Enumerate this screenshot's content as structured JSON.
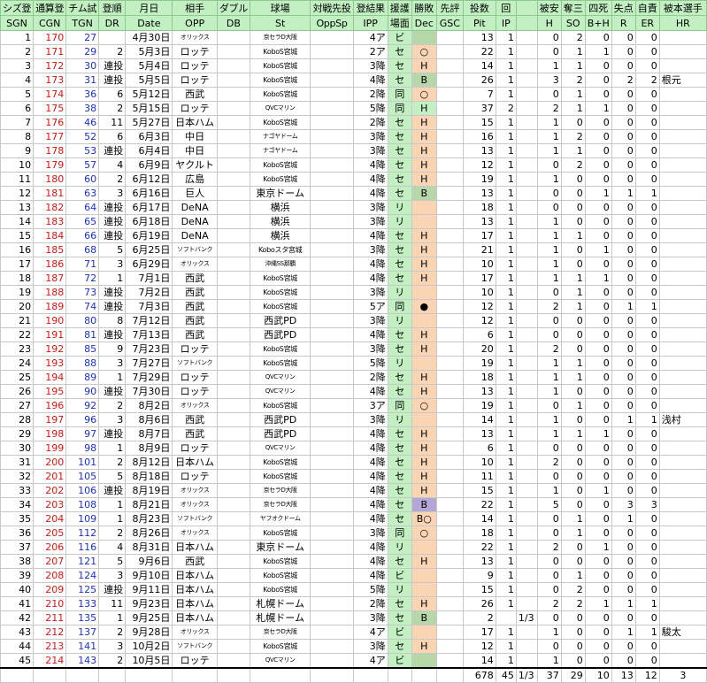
{
  "headers_jp": [
    "シズ登",
    "通算登",
    "チム試",
    "登順",
    "月日",
    "相手",
    "ダブル",
    "球場",
    "対戦先投",
    "登結果",
    "援護",
    "勝敗",
    "先評",
    "投数",
    "回",
    "",
    "被安",
    "奪三",
    "四死",
    "失点",
    "自責",
    "被本選手"
  ],
  "headers_en": [
    "SGN",
    "CGN",
    "TGN",
    "DR",
    "Date",
    "OPP",
    "DB",
    "St",
    "OppSp",
    "IPP",
    "場面",
    "Dec",
    "GSC",
    "Pit",
    "IP",
    "",
    "H",
    "SO",
    "B+H",
    "R",
    "ER",
    "HR"
  ],
  "rows": [
    {
      "sgn": "1",
      "cgn": "170",
      "tgn": "27",
      "dr": "",
      "date": "4月30日",
      "opp": "オリックス",
      "opp_small": true,
      "st": "京セラD大阪",
      "ipp": "4ア",
      "scene": "ビ",
      "dec": "",
      "dec_bg": "olv",
      "pit": "13",
      "ip": "1",
      "ipf": "",
      "h": "0",
      "so": "2",
      "bh": "0",
      "r": "0",
      "er": "0",
      "hr": ""
    },
    {
      "sgn": "2",
      "cgn": "171",
      "tgn": "29",
      "dr": "2",
      "date": "5月3日",
      "opp": "ロッテ",
      "opp_small": false,
      "st": "KoboS宮城",
      "ipp": "2ア",
      "scene": "セ",
      "dec": "○",
      "dec_bg": "sal",
      "pit": "22",
      "ip": "1",
      "ipf": "",
      "h": "0",
      "so": "1",
      "bh": "1",
      "r": "0",
      "er": "0",
      "hr": ""
    },
    {
      "sgn": "3",
      "cgn": "172",
      "tgn": "30",
      "dr": "連投",
      "date": "5月4日",
      "opp": "ロッテ",
      "opp_small": false,
      "st": "KoboS宮城",
      "ipp": "3降",
      "scene": "セ",
      "dec": "H",
      "dec_bg": "sal",
      "pit": "14",
      "ip": "1",
      "ipf": "",
      "h": "1",
      "so": "1",
      "bh": "0",
      "r": "0",
      "er": "0",
      "hr": ""
    },
    {
      "sgn": "4",
      "cgn": "173",
      "tgn": "31",
      "dr": "連投",
      "date": "5月5日",
      "opp": "ロッテ",
      "opp_small": false,
      "st": "KoboS宮城",
      "ipp": "4降",
      "scene": "セ",
      "dec": "B",
      "dec_bg": "olv",
      "pit": "26",
      "ip": "1",
      "ipf": "",
      "h": "3",
      "so": "2",
      "bh": "0",
      "r": "2",
      "er": "2",
      "hr": "根元"
    },
    {
      "sgn": "5",
      "cgn": "174",
      "tgn": "36",
      "dr": "6",
      "date": "5月12日",
      "opp": "西武",
      "opp_small": false,
      "st": "KoboS宮城",
      "ipp": "2降",
      "scene": "同",
      "dec": "○",
      "dec_bg": "sal",
      "pit": "7",
      "ip": "1",
      "ipf": "",
      "h": "0",
      "so": "1",
      "bh": "0",
      "r": "0",
      "er": "0",
      "hr": ""
    },
    {
      "sgn": "6",
      "cgn": "175",
      "tgn": "38",
      "dr": "2",
      "date": "5月15日",
      "opp": "ロッテ",
      "opp_small": false,
      "st": "QVCマリン",
      "ipp": "5降",
      "scene": "同",
      "dec": "H",
      "dec_bg": "grn",
      "pit": "37",
      "ip": "2",
      "ipf": "",
      "h": "2",
      "so": "1",
      "bh": "1",
      "r": "0",
      "er": "0",
      "hr": ""
    },
    {
      "sgn": "7",
      "cgn": "176",
      "tgn": "46",
      "dr": "11",
      "date": "5月27日",
      "opp": "日本ハム",
      "opp_small": false,
      "st": "KoboS宮城",
      "ipp": "2降",
      "scene": "セ",
      "dec": "H",
      "dec_bg": "sal",
      "pit": "15",
      "ip": "1",
      "ipf": "",
      "h": "1",
      "so": "0",
      "bh": "0",
      "r": "0",
      "er": "0",
      "hr": ""
    },
    {
      "sgn": "8",
      "cgn": "177",
      "tgn": "52",
      "dr": "6",
      "date": "6月3日",
      "opp": "中日",
      "opp_small": false,
      "st": "ナゴヤドーム",
      "ipp": "3降",
      "scene": "セ",
      "dec": "H",
      "dec_bg": "sal",
      "pit": "16",
      "ip": "1",
      "ipf": "",
      "h": "1",
      "so": "2",
      "bh": "0",
      "r": "0",
      "er": "0",
      "hr": ""
    },
    {
      "sgn": "9",
      "cgn": "178",
      "tgn": "53",
      "dr": "連投",
      "date": "6月4日",
      "opp": "中日",
      "opp_small": false,
      "st": "ナゴヤドーム",
      "ipp": "3降",
      "scene": "セ",
      "dec": "H",
      "dec_bg": "sal",
      "pit": "13",
      "ip": "1",
      "ipf": "",
      "h": "1",
      "so": "1",
      "bh": "0",
      "r": "0",
      "er": "0",
      "hr": ""
    },
    {
      "sgn": "10",
      "cgn": "179",
      "tgn": "57",
      "dr": "4",
      "date": "6月9日",
      "opp": "ヤクルト",
      "opp_small": false,
      "st": "KoboS宮城",
      "ipp": "4降",
      "scene": "セ",
      "dec": "H",
      "dec_bg": "sal",
      "pit": "12",
      "ip": "1",
      "ipf": "",
      "h": "0",
      "so": "2",
      "bh": "0",
      "r": "0",
      "er": "0",
      "hr": ""
    },
    {
      "sgn": "11",
      "cgn": "180",
      "tgn": "60",
      "dr": "2",
      "date": "6月12日",
      "opp": "広島",
      "opp_small": false,
      "st": "KoboS宮城",
      "ipp": "4降",
      "scene": "セ",
      "dec": "H",
      "dec_bg": "sal",
      "pit": "19",
      "ip": "1",
      "ipf": "",
      "h": "1",
      "so": "0",
      "bh": "0",
      "r": "0",
      "er": "0",
      "hr": ""
    },
    {
      "sgn": "12",
      "cgn": "181",
      "tgn": "63",
      "dr": "3",
      "date": "6月16日",
      "opp": "巨人",
      "opp_small": false,
      "st": "東京ドーム",
      "ipp": "4降",
      "scene": "セ",
      "dec": "B",
      "dec_bg": "olv",
      "pit": "13",
      "ip": "1",
      "ipf": "",
      "h": "0",
      "so": "0",
      "bh": "1",
      "r": "1",
      "er": "1",
      "hr": ""
    },
    {
      "sgn": "13",
      "cgn": "182",
      "tgn": "64",
      "dr": "連投",
      "date": "6月17日",
      "opp": "DeNA",
      "opp_small": false,
      "st": "横浜",
      "ipp": "3降",
      "scene": "リ",
      "dec": "",
      "dec_bg": "sal",
      "pit": "18",
      "ip": "1",
      "ipf": "",
      "h": "0",
      "so": "0",
      "bh": "0",
      "r": "0",
      "er": "0",
      "hr": ""
    },
    {
      "sgn": "14",
      "cgn": "183",
      "tgn": "65",
      "dr": "連投",
      "date": "6月18日",
      "opp": "DeNA",
      "opp_small": false,
      "st": "横浜",
      "ipp": "3降",
      "scene": "リ",
      "dec": "",
      "dec_bg": "sal",
      "pit": "13",
      "ip": "1",
      "ipf": "",
      "h": "1",
      "so": "0",
      "bh": "0",
      "r": "0",
      "er": "0",
      "hr": ""
    },
    {
      "sgn": "15",
      "cgn": "184",
      "tgn": "66",
      "dr": "連投",
      "date": "6月19日",
      "opp": "DeNA",
      "opp_small": false,
      "st": "横浜",
      "ipp": "4降",
      "scene": "セ",
      "dec": "H",
      "dec_bg": "sal",
      "pit": "17",
      "ip": "1",
      "ipf": "",
      "h": "1",
      "so": "1",
      "bh": "0",
      "r": "0",
      "er": "0",
      "hr": ""
    },
    {
      "sgn": "16",
      "cgn": "185",
      "tgn": "68",
      "dr": "5",
      "date": "6月25日",
      "opp": "ソフトバンク",
      "opp_small": true,
      "st": "Koboスタ宮城",
      "ipp": "3降",
      "scene": "セ",
      "dec": "H",
      "dec_bg": "sal",
      "pit": "21",
      "ip": "1",
      "ipf": "",
      "h": "1",
      "so": "0",
      "bh": "1",
      "r": "0",
      "er": "0",
      "hr": ""
    },
    {
      "sgn": "17",
      "cgn": "186",
      "tgn": "71",
      "dr": "3",
      "date": "6月29日",
      "opp": "オリックス",
      "opp_small": true,
      "st": "沖縄SS那覇",
      "ipp": "4降",
      "scene": "セ",
      "dec": "H",
      "dec_bg": "sal",
      "pit": "10",
      "ip": "1",
      "ipf": "",
      "h": "1",
      "so": "0",
      "bh": "0",
      "r": "0",
      "er": "0",
      "hr": ""
    },
    {
      "sgn": "18",
      "cgn": "187",
      "tgn": "72",
      "dr": "1",
      "date": "7月1日",
      "opp": "西武",
      "opp_small": false,
      "st": "KoboS宮城",
      "ipp": "4降",
      "scene": "セ",
      "dec": "H",
      "dec_bg": "sal",
      "pit": "17",
      "ip": "1",
      "ipf": "",
      "h": "1",
      "so": "1",
      "bh": "1",
      "r": "0",
      "er": "0",
      "hr": ""
    },
    {
      "sgn": "19",
      "cgn": "188",
      "tgn": "73",
      "dr": "連投",
      "date": "7月2日",
      "opp": "西武",
      "opp_small": false,
      "st": "KoboS宮城",
      "ipp": "3降",
      "scene": "リ",
      "dec": "",
      "dec_bg": "sal",
      "pit": "10",
      "ip": "1",
      "ipf": "",
      "h": "0",
      "so": "1",
      "bh": "0",
      "r": "0",
      "er": "0",
      "hr": ""
    },
    {
      "sgn": "20",
      "cgn": "189",
      "tgn": "74",
      "dr": "連投",
      "date": "7月3日",
      "opp": "西武",
      "opp_small": false,
      "st": "KoboS宮城",
      "ipp": "5ア",
      "scene": "同",
      "dec": "●",
      "dec_bg": "sal",
      "pit": "12",
      "ip": "1",
      "ipf": "",
      "h": "2",
      "so": "1",
      "bh": "0",
      "r": "1",
      "er": "1",
      "hr": ""
    },
    {
      "sgn": "21",
      "cgn": "190",
      "tgn": "80",
      "dr": "8",
      "date": "7月12日",
      "opp": "西武",
      "opp_small": false,
      "st": "西武PD",
      "ipp": "3降",
      "scene": "リ",
      "dec": "",
      "dec_bg": "sal",
      "pit": "12",
      "ip": "1",
      "ipf": "",
      "h": "0",
      "so": "0",
      "bh": "0",
      "r": "0",
      "er": "0",
      "hr": ""
    },
    {
      "sgn": "22",
      "cgn": "191",
      "tgn": "81",
      "dr": "連投",
      "date": "7月13日",
      "opp": "西武",
      "opp_small": false,
      "st": "西武PD",
      "ipp": "4降",
      "scene": "セ",
      "dec": "H",
      "dec_bg": "sal",
      "pit": "6",
      "ip": "1",
      "ipf": "",
      "h": "0",
      "so": "0",
      "bh": "0",
      "r": "0",
      "er": "0",
      "hr": ""
    },
    {
      "sgn": "23",
      "cgn": "192",
      "tgn": "85",
      "dr": "9",
      "date": "7月23日",
      "opp": "ロッテ",
      "opp_small": false,
      "st": "KoboS宮城",
      "ipp": "3降",
      "scene": "セ",
      "dec": "H",
      "dec_bg": "sal",
      "pit": "20",
      "ip": "1",
      "ipf": "",
      "h": "2",
      "so": "0",
      "bh": "0",
      "r": "0",
      "er": "0",
      "hr": ""
    },
    {
      "sgn": "24",
      "cgn": "193",
      "tgn": "88",
      "dr": "3",
      "date": "7月27日",
      "opp": "ソフトバンク",
      "opp_small": true,
      "st": "KoboS宮城",
      "ipp": "5降",
      "scene": "リ",
      "dec": "",
      "dec_bg": "sal",
      "pit": "19",
      "ip": "1",
      "ipf": "",
      "h": "1",
      "so": "1",
      "bh": "0",
      "r": "0",
      "er": "0",
      "hr": ""
    },
    {
      "sgn": "25",
      "cgn": "194",
      "tgn": "89",
      "dr": "1",
      "date": "7月29日",
      "opp": "ロッテ",
      "opp_small": false,
      "st": "QVCマリン",
      "ipp": "2降",
      "scene": "セ",
      "dec": "H",
      "dec_bg": "sal",
      "pit": "18",
      "ip": "1",
      "ipf": "",
      "h": "1",
      "so": "1",
      "bh": "0",
      "r": "0",
      "er": "0",
      "hr": ""
    },
    {
      "sgn": "26",
      "cgn": "195",
      "tgn": "90",
      "dr": "連投",
      "date": "7月30日",
      "opp": "ロッテ",
      "opp_small": false,
      "st": "QVCマリン",
      "ipp": "4降",
      "scene": "セ",
      "dec": "H",
      "dec_bg": "sal",
      "pit": "13",
      "ip": "1",
      "ipf": "",
      "h": "1",
      "so": "0",
      "bh": "0",
      "r": "0",
      "er": "0",
      "hr": ""
    },
    {
      "sgn": "27",
      "cgn": "196",
      "tgn": "92",
      "dr": "2",
      "date": "8月2日",
      "opp": "オリックス",
      "opp_small": true,
      "st": "KoboS宮城",
      "ipp": "3ア",
      "scene": "同",
      "dec": "○",
      "dec_bg": "sal",
      "pit": "19",
      "ip": "1",
      "ipf": "",
      "h": "0",
      "so": "1",
      "bh": "0",
      "r": "0",
      "er": "0",
      "hr": ""
    },
    {
      "sgn": "28",
      "cgn": "197",
      "tgn": "96",
      "dr": "3",
      "date": "8月6日",
      "opp": "西武",
      "opp_small": false,
      "st": "西武PD",
      "ipp": "3降",
      "scene": "リ",
      "dec": "",
      "dec_bg": "sal",
      "pit": "14",
      "ip": "1",
      "ipf": "",
      "h": "1",
      "so": "0",
      "bh": "0",
      "r": "1",
      "er": "1",
      "hr": "浅村"
    },
    {
      "sgn": "29",
      "cgn": "198",
      "tgn": "97",
      "dr": "連投",
      "date": "8月7日",
      "opp": "西武",
      "opp_small": false,
      "st": "西武PD",
      "ipp": "4降",
      "scene": "セ",
      "dec": "H",
      "dec_bg": "sal",
      "pit": "13",
      "ip": "1",
      "ipf": "",
      "h": "1",
      "so": "1",
      "bh": "1",
      "r": "0",
      "er": "0",
      "hr": ""
    },
    {
      "sgn": "30",
      "cgn": "199",
      "tgn": "98",
      "dr": "1",
      "date": "8月9日",
      "opp": "ロッテ",
      "opp_small": false,
      "st": "QVCマリン",
      "ipp": "4降",
      "scene": "セ",
      "dec": "H",
      "dec_bg": "sal",
      "pit": "6",
      "ip": "1",
      "ipf": "",
      "h": "0",
      "so": "0",
      "bh": "0",
      "r": "0",
      "er": "0",
      "hr": ""
    },
    {
      "sgn": "31",
      "cgn": "200",
      "tgn": "101",
      "dr": "2",
      "date": "8月12日",
      "opp": "日本ハム",
      "opp_small": false,
      "st": "KoboS宮城",
      "ipp": "4降",
      "scene": "セ",
      "dec": "H",
      "dec_bg": "sal",
      "pit": "10",
      "ip": "1",
      "ipf": "",
      "h": "2",
      "so": "0",
      "bh": "0",
      "r": "0",
      "er": "0",
      "hr": ""
    },
    {
      "sgn": "32",
      "cgn": "201",
      "tgn": "105",
      "dr": "5",
      "date": "8月18日",
      "opp": "ロッテ",
      "opp_small": false,
      "st": "KoboS宮城",
      "ipp": "4降",
      "scene": "セ",
      "dec": "H",
      "dec_bg": "sal",
      "pit": "11",
      "ip": "1",
      "ipf": "",
      "h": "0",
      "so": "0",
      "bh": "0",
      "r": "0",
      "er": "0",
      "hr": ""
    },
    {
      "sgn": "33",
      "cgn": "202",
      "tgn": "106",
      "dr": "連投",
      "date": "8月19日",
      "opp": "オリックス",
      "opp_small": true,
      "st": "京セラD大阪",
      "ipp": "4降",
      "scene": "セ",
      "dec": "H",
      "dec_bg": "sal",
      "pit": "15",
      "ip": "1",
      "ipf": "",
      "h": "1",
      "so": "0",
      "bh": "1",
      "r": "0",
      "er": "0",
      "hr": ""
    },
    {
      "sgn": "34",
      "cgn": "203",
      "tgn": "108",
      "dr": "1",
      "date": "8月21日",
      "opp": "オリックス",
      "opp_small": true,
      "st": "京セラD大阪",
      "ipp": "4降",
      "scene": "セ",
      "dec": "B",
      "dec_bg": "pur",
      "pit": "22",
      "ip": "1",
      "ipf": "",
      "h": "5",
      "so": "0",
      "bh": "0",
      "r": "3",
      "er": "3",
      "hr": ""
    },
    {
      "sgn": "35",
      "cgn": "204",
      "tgn": "109",
      "dr": "1",
      "date": "8月23日",
      "opp": "ソフトバンク",
      "opp_small": true,
      "st": "ヤフオクドーム",
      "ipp": "4降",
      "scene": "セ",
      "dec": "B○",
      "dec_bg": "sal",
      "pit": "14",
      "ip": "1",
      "ipf": "",
      "h": "0",
      "so": "1",
      "bh": "0",
      "r": "1",
      "er": "0",
      "hr": ""
    },
    {
      "sgn": "36",
      "cgn": "205",
      "tgn": "112",
      "dr": "2",
      "date": "8月26日",
      "opp": "オリックス",
      "opp_small": true,
      "st": "KoboS宮城",
      "ipp": "3降",
      "scene": "同",
      "dec": "○",
      "dec_bg": "sal",
      "pit": "18",
      "ip": "1",
      "ipf": "",
      "h": "0",
      "so": "1",
      "bh": "0",
      "r": "0",
      "er": "0",
      "hr": ""
    },
    {
      "sgn": "37",
      "cgn": "206",
      "tgn": "116",
      "dr": "4",
      "date": "8月31日",
      "opp": "日本ハム",
      "opp_small": false,
      "st": "東京ドーム",
      "ipp": "4降",
      "scene": "リ",
      "dec": "",
      "dec_bg": "sal",
      "pit": "22",
      "ip": "1",
      "ipf": "",
      "h": "2",
      "so": "0",
      "bh": "1",
      "r": "0",
      "er": "0",
      "hr": ""
    },
    {
      "sgn": "38",
      "cgn": "207",
      "tgn": "121",
      "dr": "5",
      "date": "9月6日",
      "opp": "西武",
      "opp_small": false,
      "st": "KoboS宮城",
      "ipp": "4降",
      "scene": "セ",
      "dec": "H",
      "dec_bg": "sal",
      "pit": "13",
      "ip": "1",
      "ipf": "",
      "h": "0",
      "so": "0",
      "bh": "0",
      "r": "0",
      "er": "0",
      "hr": ""
    },
    {
      "sgn": "39",
      "cgn": "208",
      "tgn": "124",
      "dr": "3",
      "date": "9月10日",
      "opp": "日本ハム",
      "opp_small": false,
      "st": "KoboS宮城",
      "ipp": "4降",
      "scene": "ビ",
      "dec": "",
      "dec_bg": "sal",
      "pit": "9",
      "ip": "1",
      "ipf": "",
      "h": "0",
      "so": "1",
      "bh": "0",
      "r": "0",
      "er": "0",
      "hr": ""
    },
    {
      "sgn": "40",
      "cgn": "209",
      "tgn": "125",
      "dr": "連投",
      "date": "9月11日",
      "opp": "日本ハム",
      "opp_small": false,
      "st": "KoboS宮城",
      "ipp": "5降",
      "scene": "リ",
      "dec": "",
      "dec_bg": "sal",
      "pit": "15",
      "ip": "1",
      "ipf": "",
      "h": "0",
      "so": "2",
      "bh": "0",
      "r": "0",
      "er": "0",
      "hr": ""
    },
    {
      "sgn": "41",
      "cgn": "210",
      "tgn": "133",
      "dr": "11",
      "date": "9月23日",
      "opp": "日本ハム",
      "opp_small": false,
      "st": "札幌ドーム",
      "ipp": "2降",
      "scene": "セ",
      "dec": "H",
      "dec_bg": "sal",
      "pit": "26",
      "ip": "1",
      "ipf": "",
      "h": "2",
      "so": "2",
      "bh": "1",
      "r": "1",
      "er": "1",
      "hr": ""
    },
    {
      "sgn": "42",
      "cgn": "211",
      "tgn": "135",
      "dr": "1",
      "date": "9月25日",
      "opp": "日本ハム",
      "opp_small": false,
      "st": "札幌ドーム",
      "ipp": "3降",
      "scene": "セ",
      "dec": "B",
      "dec_bg": "olv",
      "pit": "2",
      "ip": "",
      "ipf": "1/3",
      "h": "0",
      "so": "0",
      "bh": "0",
      "r": "0",
      "er": "0",
      "hr": ""
    },
    {
      "sgn": "43",
      "cgn": "212",
      "tgn": "137",
      "dr": "2",
      "date": "9月28日",
      "opp": "オリックス",
      "opp_small": true,
      "st": "京セラD大阪",
      "ipp": "4ア",
      "scene": "ビ",
      "dec": "",
      "dec_bg": "sal",
      "pit": "17",
      "ip": "1",
      "ipf": "",
      "h": "1",
      "so": "0",
      "bh": "0",
      "r": "1",
      "er": "1",
      "hr": "駿太"
    },
    {
      "sgn": "44",
      "cgn": "213",
      "tgn": "141",
      "dr": "3",
      "date": "10月2日",
      "opp": "ソフトバンク",
      "opp_small": true,
      "st": "KoboS宮城",
      "ipp": "3降",
      "scene": "セ",
      "dec": "H",
      "dec_bg": "sal",
      "pit": "12",
      "ip": "1",
      "ipf": "",
      "h": "0",
      "so": "0",
      "bh": "0",
      "r": "0",
      "er": "0",
      "hr": ""
    },
    {
      "sgn": "45",
      "cgn": "214",
      "tgn": "143",
      "dr": "2",
      "date": "10月5日",
      "opp": "ロッテ",
      "opp_small": false,
      "st": "QVCマリン",
      "ipp": "4ア",
      "scene": "ビ",
      "dec": "",
      "dec_bg": "olv",
      "pit": "14",
      "ip": "1",
      "ipf": "",
      "h": "1",
      "so": "0",
      "bh": "0",
      "r": "0",
      "er": "0",
      "hr": ""
    }
  ],
  "totals": {
    "pit": "678",
    "ip": "45",
    "ipf": "1/3",
    "h": "37",
    "so": "29",
    "bh": "10",
    "r": "13",
    "er": "12",
    "hr": "3"
  }
}
